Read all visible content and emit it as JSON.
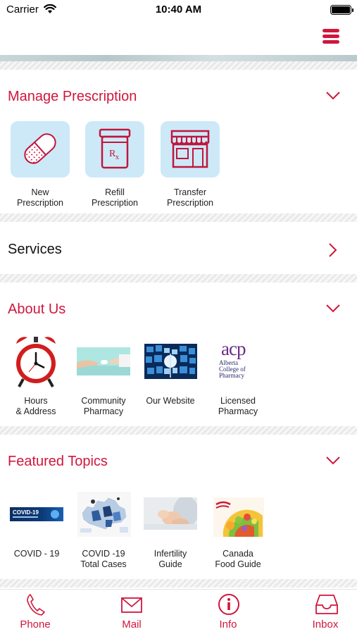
{
  "status_bar": {
    "carrier": "Carrier",
    "time": "10:40 AM"
  },
  "colors": {
    "accent": "#d0163c",
    "tile_bg": "#cde9f8"
  },
  "sections": {
    "manage": {
      "title": "Manage Prescription",
      "items": [
        {
          "icon": "pill-icon",
          "label_1": "New",
          "label_2": "Prescription"
        },
        {
          "icon": "rx-bottle-icon",
          "label_1": "Refill",
          "label_2": "Prescription"
        },
        {
          "icon": "storefront-icon",
          "label_1": "Transfer",
          "label_2": "Prescription"
        }
      ]
    },
    "services": {
      "title": "Services"
    },
    "about": {
      "title": "About Us",
      "items": [
        {
          "icon": "alarm-clock-image",
          "label_1": "Hours",
          "label_2": "& Address"
        },
        {
          "icon": "handing-pills-image",
          "label_1": "Community",
          "label_2": "Pharmacy"
        },
        {
          "icon": "website-tiles-image",
          "label_1": "Our Website",
          "label_2": ""
        },
        {
          "icon": "acp-logo",
          "label_1": "Licensed",
          "label_2": "Pharmacy"
        }
      ],
      "acp_logo_text": {
        "mark": "acp",
        "line_1": "Alberta",
        "line_2": "College of",
        "line_3": "Pharmacy"
      }
    },
    "featured": {
      "title": "Featured Topics",
      "items": [
        {
          "icon": "covid-banner-image",
          "label_1": "COVID - 19",
          "label_2": "",
          "banner_text": "COVID-19"
        },
        {
          "icon": "canada-map-image",
          "label_1": "COVID -19",
          "label_2": "Total Cases"
        },
        {
          "icon": "baby-photo-image",
          "label_1": "Infertility",
          "label_2": "Guide"
        },
        {
          "icon": "food-guide-image",
          "label_1": "Canada",
          "label_2": "Food Guide"
        }
      ]
    }
  },
  "tab_bar": {
    "items": [
      {
        "icon": "phone-icon",
        "label": "Phone"
      },
      {
        "icon": "mail-icon",
        "label": "Mail"
      },
      {
        "icon": "info-icon",
        "label": "Info"
      },
      {
        "icon": "inbox-icon",
        "label": "Inbox"
      }
    ]
  }
}
